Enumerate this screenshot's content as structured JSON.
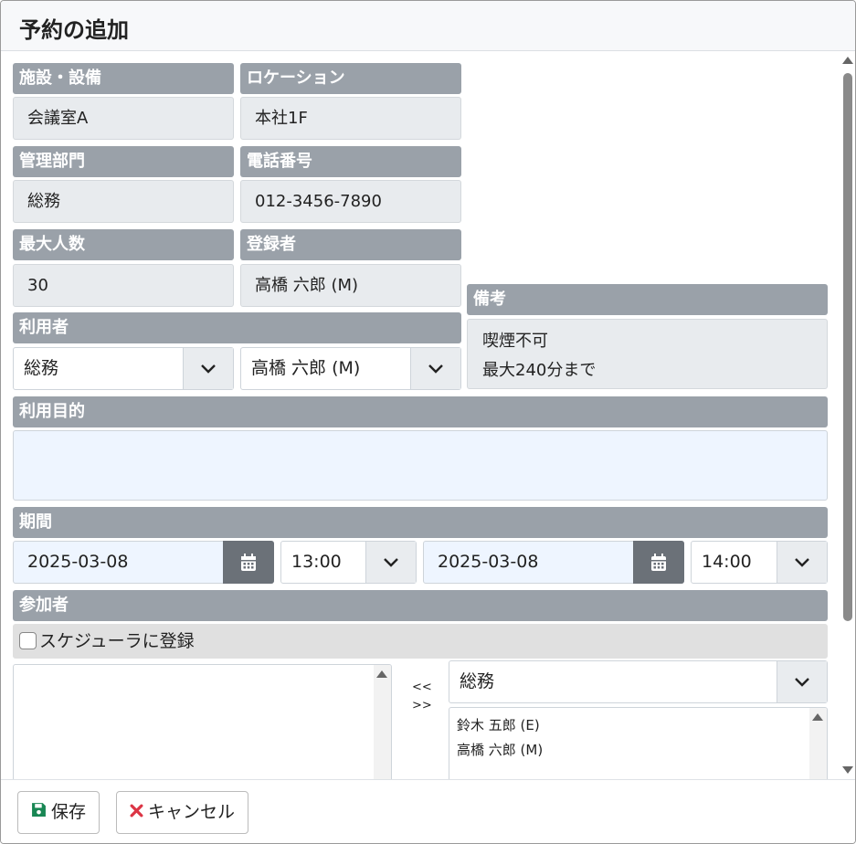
{
  "dialog": {
    "title": "予約の追加"
  },
  "facility": {
    "label": "施設・設備",
    "value": "会議室A"
  },
  "location": {
    "label": "ロケーション",
    "value": "本社1F"
  },
  "department": {
    "label": "管理部門",
    "value": "総務"
  },
  "phone": {
    "label": "電話番号",
    "value": "012-3456-7890"
  },
  "capacity": {
    "label": "最大人数",
    "value": "30"
  },
  "registrant": {
    "label": "登録者",
    "value": "高橋 六郎 (M)"
  },
  "notes": {
    "label": "備考",
    "lines": [
      "喫煙不可",
      "最大240分まで"
    ]
  },
  "user": {
    "label": "利用者",
    "department": "総務",
    "person": "高橋 六郎 (M)"
  },
  "purpose": {
    "label": "利用目的",
    "value": ""
  },
  "period": {
    "label": "期間",
    "start_date": "2025-03-08",
    "start_time": "13:00",
    "end_date": "2025-03-08",
    "end_time": "14:00"
  },
  "participants": {
    "label": "参加者",
    "scheduler_checkbox_label": "スケジューラに登録",
    "scheduler_checked": false,
    "selected": [],
    "add_arrow": "<<",
    "remove_arrow": ">>",
    "group": "総務",
    "candidates": [
      "鈴木 五郎 (E)",
      "高橋 六郎 (M)"
    ]
  },
  "footer": {
    "save_label": "保存",
    "cancel_label": "キャンセル"
  },
  "colors": {
    "header_bg": "#9aa1a9",
    "save_icon": "#198754",
    "cancel_icon": "#dc3545"
  }
}
